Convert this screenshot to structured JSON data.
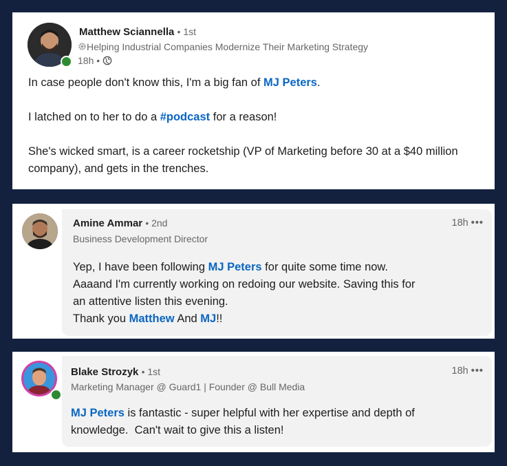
{
  "post": {
    "author": "Matthew Sciannella",
    "degree": "1st",
    "headline": "Helping Industrial Companies Modernize Their Marketing Strategy",
    "time": "18h",
    "text": {
      "p1_before": "In case people don't know this, I'm a big fan of ",
      "p1_mention": "MJ Peters",
      "p1_after": ".",
      "p2_before": "I latched on to her to do a ",
      "p2_hashtag": "#podcast",
      "p2_after": " for a reason!",
      "p3": "She's wicked smart, is a career rocketship (VP of Marketing before 30 at a $40 million company), and gets in the trenches."
    }
  },
  "comments": [
    {
      "author": "Amine Ammar",
      "degree": "2nd",
      "headline": "Business Development Director",
      "time": "18h",
      "text": {
        "l1_before": "Yep, I have been following ",
        "l1_mention": "MJ Peters",
        "l1_after": " for quite some time now.",
        "l2": "Aaaand I'm currently working on redoing our website. Saving this for",
        "l3": "an attentive listen this evening.",
        "l4_before": "Thank you ",
        "l4_mention1": "Matthew",
        "l4_mid": " And ",
        "l4_mention2": "MJ",
        "l4_after": "!!"
      }
    },
    {
      "author": "Blake Strozyk",
      "degree": "1st",
      "headline": "Marketing Manager @ Guard1 | Founder @ Bull Media",
      "time": "18h",
      "text": {
        "mention": "MJ Peters",
        "l1_after": " is fantastic - super helpful with her expertise and depth of",
        "l2": "knowledge.  Can't wait to give this a listen!"
      }
    }
  ]
}
